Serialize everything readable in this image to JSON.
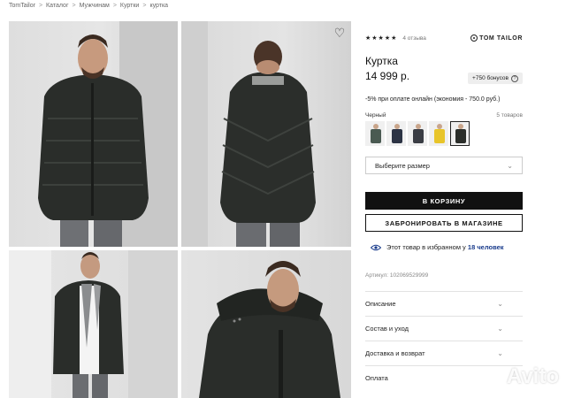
{
  "breadcrumb": [
    "TomTailor",
    "Каталог",
    "Мужчинам",
    "Куртки",
    "куртка"
  ],
  "breadcrumb_separator": ">",
  "rating": {
    "stars_text": "★★★★★",
    "value": 5,
    "reviews": "4 отзыва"
  },
  "brand": "TOM TAILOR",
  "product": {
    "title": "Куртка",
    "price": "14 999 р.",
    "bonus": "+750 бонусов",
    "promo": "-5% при оплате онлайн (экономия - 750.0 руб.)",
    "color": "Черный",
    "items_count": "5 товаров",
    "swatch_colors": [
      "#4a5a52",
      "#2c3344",
      "#3a3d44",
      "#e8c52a",
      "#2b2e2a"
    ],
    "selected_swatch": 4,
    "size_placeholder": "Выберите размер",
    "cart_button": "В КОРЗИНУ",
    "reserve_button": "ЗАБРОНИРОВАТЬ В МАГАЗИНЕ",
    "favorites_text": "Этот товар в избранном у",
    "favorites_count": "18 человек",
    "article": "Артикул: 102069529999"
  },
  "accordion": [
    "Описание",
    "Состав и уход",
    "Доставка и возврат",
    "Оплата"
  ],
  "watermark": "Avito",
  "colors": {
    "accent": "#1a3c8c",
    "button_dark": "#111111"
  }
}
